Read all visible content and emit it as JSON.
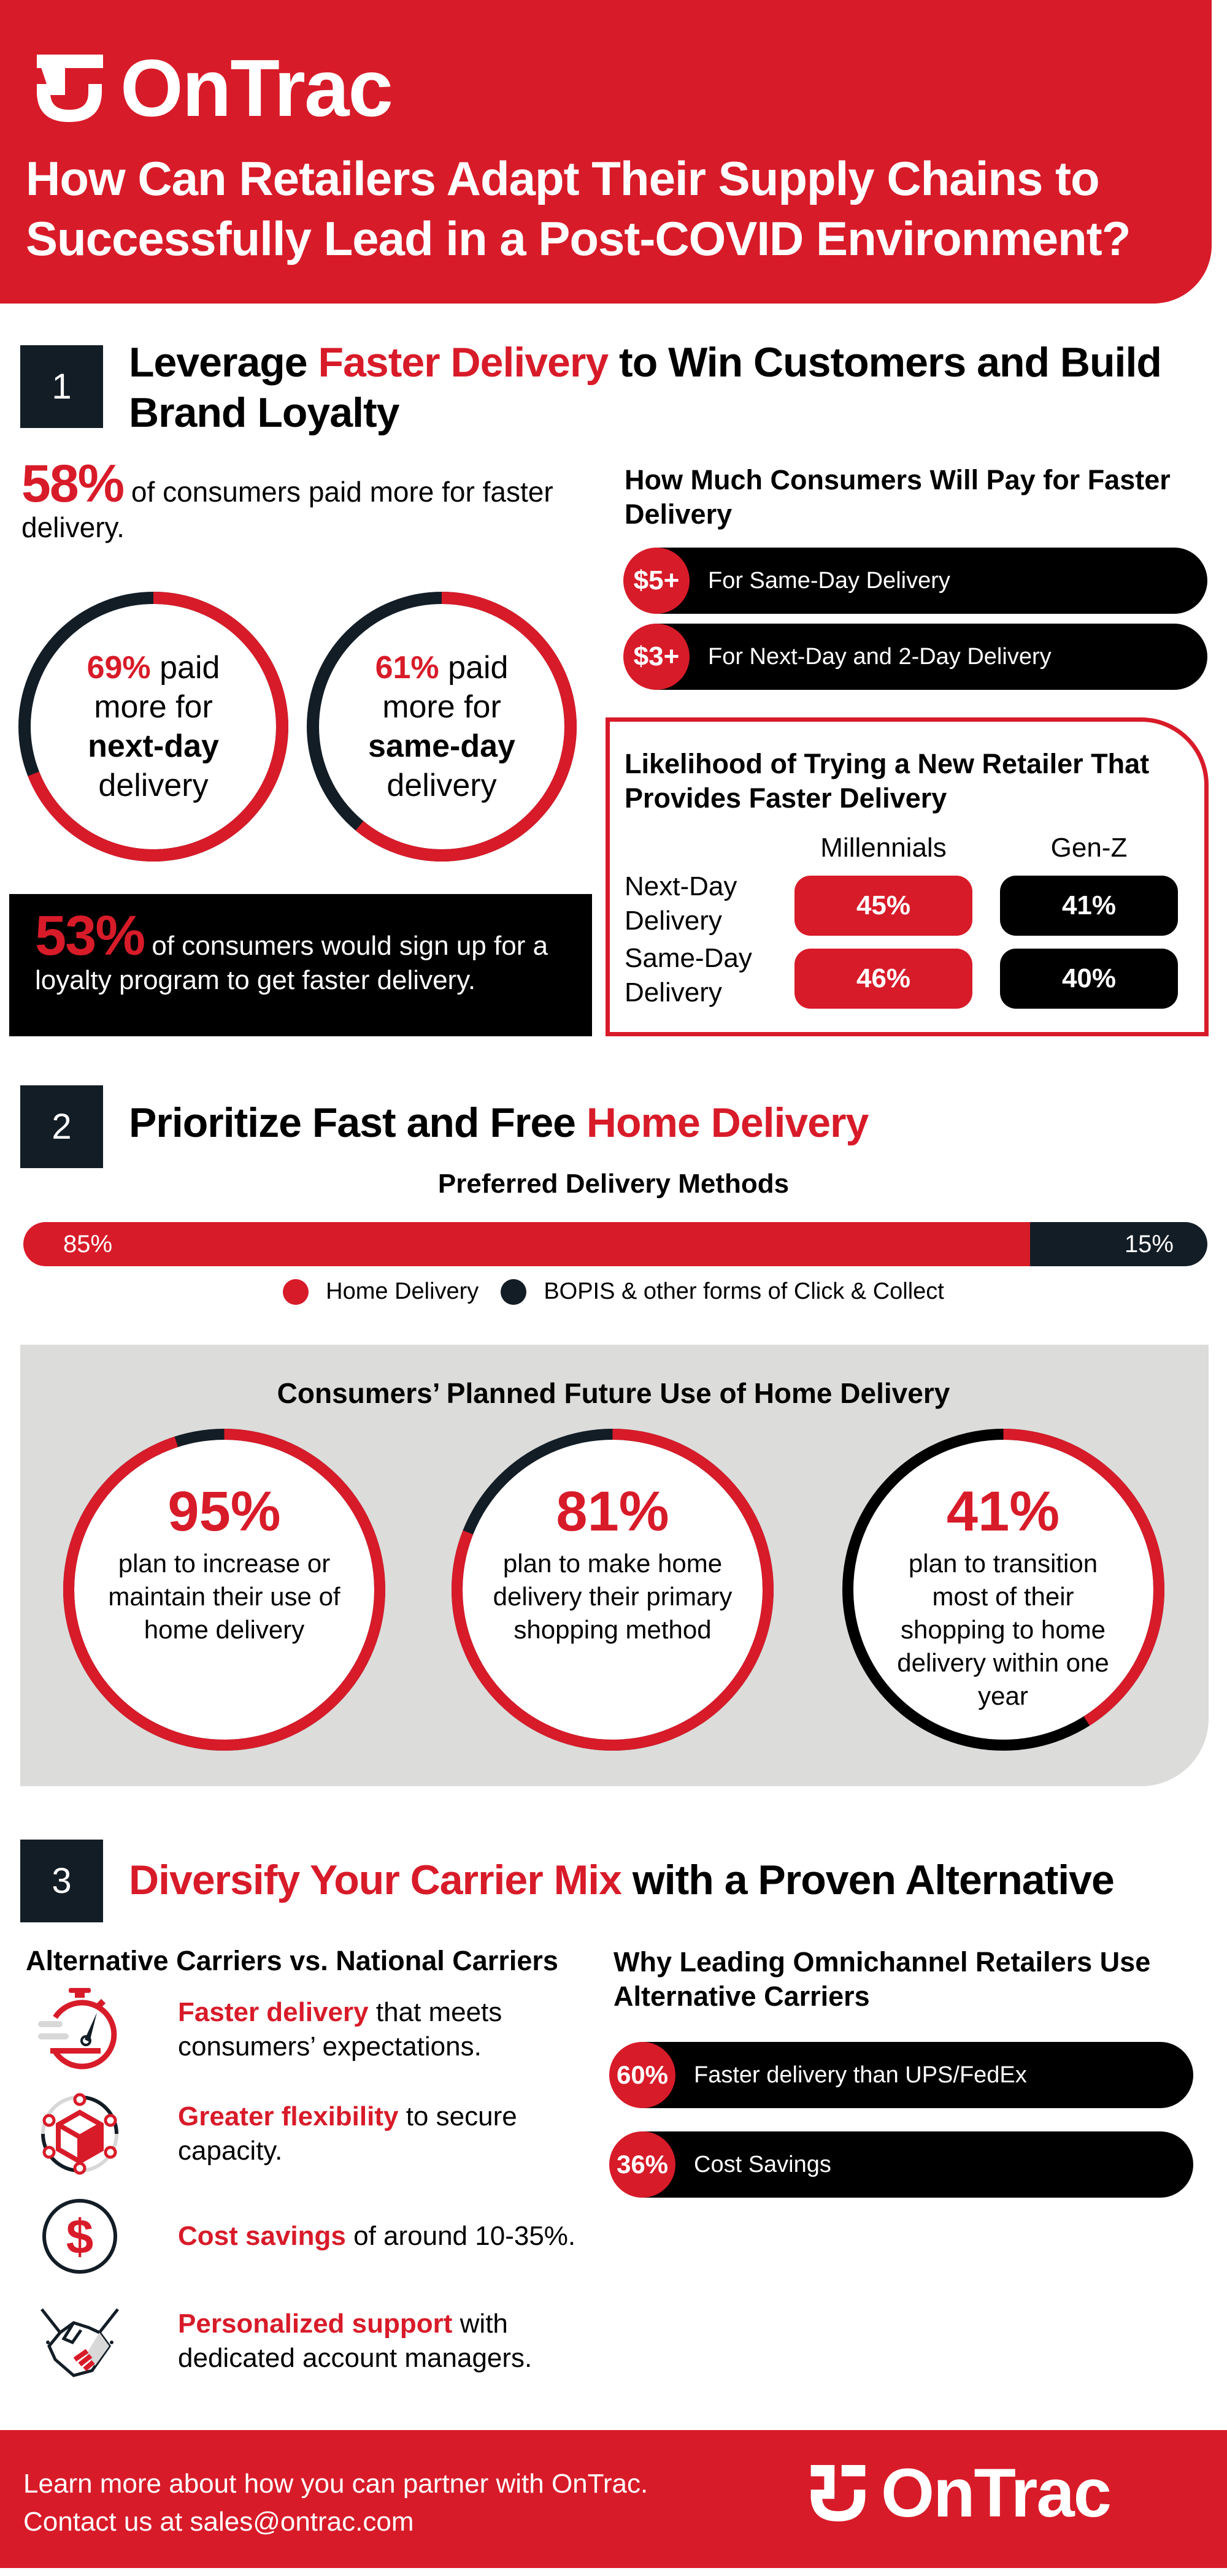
{
  "brand": {
    "name": "OnTrac",
    "logo_icon": "ontrac-logo-icon",
    "colors": {
      "red": "#D81B29",
      "navy": "#131D26",
      "black": "#000000",
      "gray": "#DCDCDA"
    }
  },
  "header": {
    "title": "How Can Retailers Adapt Their Supply Chains to Successfully Lead in a Post-COVID Environment?"
  },
  "section1": {
    "number": "1",
    "title_pre": "Leverage ",
    "title_hl": "Faster Delivery",
    "title_post": " to Win Customers and Build Brand Loyalty",
    "stat58": {
      "value": "58%",
      "text": " of consumers paid more for faster delivery."
    },
    "rings": [
      {
        "value": "69%",
        "suffix": " paid",
        "line2": "more for",
        "line3": "next-day",
        "line4": "delivery",
        "percent": 69
      },
      {
        "value": "61%",
        "suffix": " paid",
        "line2": "more for",
        "line3": "same-day",
        "line4": "delivery",
        "percent": 61
      }
    ],
    "stat53": {
      "value": "53%",
      "text": " of consumers would sign up for a loyalty program to get faster delivery."
    },
    "pay": {
      "title": "How Much Consumers Will Pay for Faster Delivery",
      "items": [
        {
          "amount": "$5+",
          "label": "For Same-Day Delivery"
        },
        {
          "amount": "$3+",
          "label": "For Next-Day and 2-Day Delivery"
        }
      ]
    },
    "likelihood": {
      "title": "Likelihood of Trying a New Retailer That Provides Faster Delivery",
      "columns": [
        "Millennials",
        "Gen-Z"
      ],
      "rows": [
        {
          "label": "Next-Day Delivery",
          "values": [
            "45%",
            "41%"
          ]
        },
        {
          "label": "Same-Day Delivery",
          "values": [
            "46%",
            "40%"
          ]
        }
      ]
    }
  },
  "section2": {
    "number": "2",
    "title_pre": "Prioritize Fast and Free ",
    "title_hl": "Home Delivery",
    "preferred": {
      "title": "Preferred Delivery Methods",
      "segments": [
        {
          "name": "Home Delivery",
          "label": "85%",
          "percent": 85,
          "color": "#D81B29"
        },
        {
          "name": "BOPIS & other forms of Click & Collect",
          "label": "15%",
          "percent": 15,
          "color": "#131D26"
        }
      ]
    },
    "future": {
      "title": "Consumers’  Planned Future Use of Home Delivery",
      "rings": [
        {
          "value": "95%",
          "text": "plan to increase or maintain their use of home delivery",
          "percent": 95,
          "rest_color": "#131D26"
        },
        {
          "value": "81%",
          "text": "plan to make home delivery their primary shopping method",
          "percent": 81,
          "rest_color": "#131D26"
        },
        {
          "value": "41%",
          "text": "plan to transition most of their shopping to home delivery within one year",
          "percent": 41,
          "rest_color": "#000000"
        }
      ]
    }
  },
  "section3": {
    "number": "3",
    "title_hl": "Diversify Your Carrier Mix",
    "title_post": " with a Proven Alternative",
    "alt_title": "Alternative Carriers vs. National Carriers",
    "benefits": [
      {
        "icon": "stopwatch-icon",
        "hl": "Faster delivery",
        "text": " that meets consumers’ expectations."
      },
      {
        "icon": "network-box-icon",
        "hl": "Greater flexibility",
        "text": " to secure capacity."
      },
      {
        "icon": "dollar-circle-icon",
        "hl": "Cost savings",
        "text": " of around 10-35%."
      },
      {
        "icon": "handshake-icon",
        "hl": "Personalized support",
        "text": " with dedicated account managers."
      }
    ],
    "why": {
      "title": "Why Leading Omnichannel Retailers Use Alternative Carriers",
      "items": [
        {
          "value": "60%",
          "label": "Faster delivery than UPS/FedEx"
        },
        {
          "value": "36%",
          "label": "Cost Savings"
        }
      ]
    }
  },
  "footer": {
    "line1": "Learn more about how you can partner with OnTrac.",
    "line2": "Contact us at sales@ontrac.com"
  }
}
